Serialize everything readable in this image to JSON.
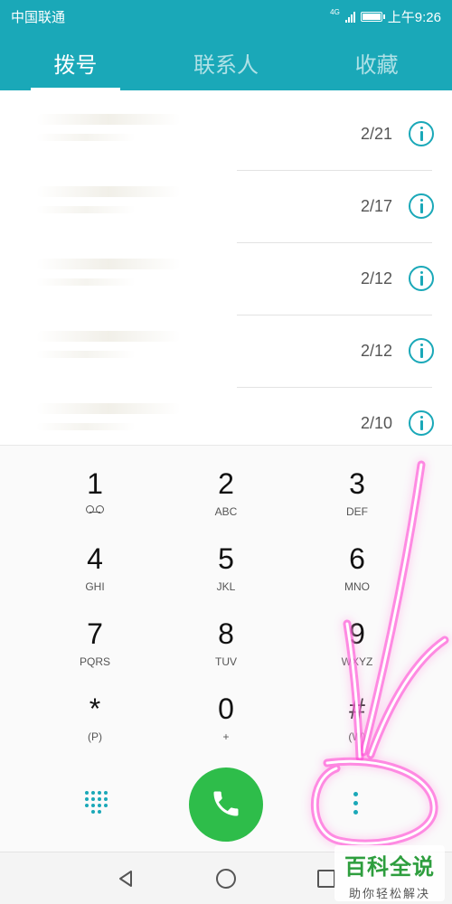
{
  "status_bar": {
    "carrier": "中国联通",
    "network": "4G",
    "time": "上午9:26"
  },
  "tabs": [
    {
      "label": "拨号",
      "active": true
    },
    {
      "label": "联系人",
      "active": false
    },
    {
      "label": "收藏",
      "active": false
    }
  ],
  "call_log": [
    {
      "date": "2/21"
    },
    {
      "date": "2/17"
    },
    {
      "date": "2/12"
    },
    {
      "date": "2/12"
    },
    {
      "date": "2/10"
    }
  ],
  "dialpad": {
    "keys": [
      {
        "digit": "1",
        "letters": ""
      },
      {
        "digit": "2",
        "letters": "ABC"
      },
      {
        "digit": "3",
        "letters": "DEF"
      },
      {
        "digit": "4",
        "letters": "GHI"
      },
      {
        "digit": "5",
        "letters": "JKL"
      },
      {
        "digit": "6",
        "letters": "MNO"
      },
      {
        "digit": "7",
        "letters": "PQRS"
      },
      {
        "digit": "8",
        "letters": "TUV"
      },
      {
        "digit": "9",
        "letters": "WXYZ"
      },
      {
        "digit": "*",
        "letters": "(P)"
      },
      {
        "digit": "0",
        "letters": "+"
      },
      {
        "digit": "#",
        "letters": "(W)"
      }
    ]
  },
  "colors": {
    "accent": "#1aa8b8",
    "call_green": "#2ebd4a",
    "annotation_pink": "#ff3bd6"
  },
  "icons": {
    "info": "info-circle-icon",
    "dialpad_toggle": "dialpad-grid-icon",
    "call": "phone-icon",
    "more": "more-vertical-icon",
    "voicemail": "voicemail-icon"
  },
  "watermark": {
    "title": "百科全说",
    "subtitle": "助你轻松解决"
  }
}
